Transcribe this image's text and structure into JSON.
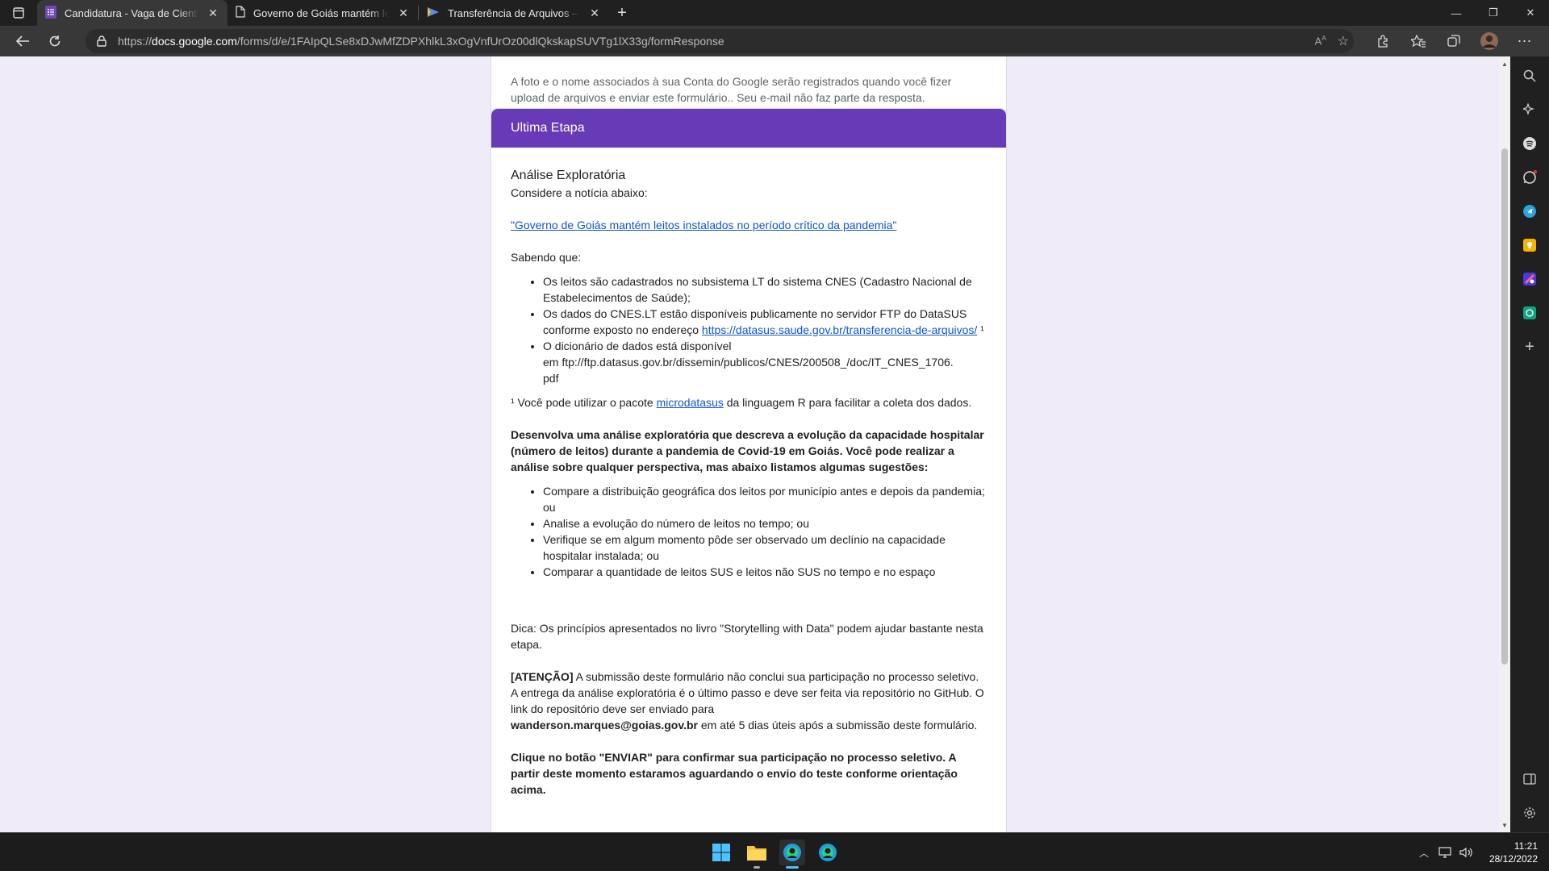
{
  "browser": {
    "tabs": [
      {
        "title": "Candidatura - Vaga de Cientista",
        "active": true,
        "icon": "google-forms-icon"
      },
      {
        "title": "Governo de Goiás mantém leitos",
        "active": false,
        "icon": "document-icon"
      },
      {
        "title": "Transferência de Arquivos – DATA",
        "active": false,
        "icon": "datasus-icon"
      }
    ],
    "url_prefix": "https://",
    "url_host": "docs.google.com",
    "url_path": "/forms/d/e/1FAIpQLSe8xDJwMfZDPXhlkL3xOgVnfUrOz00dlQkskapSUVTg1lX33g/formResponse"
  },
  "form": {
    "prev_card_text": "A foto e o nome associados à sua Conta do Google serão registrados quando você fizer upload de arquivos e enviar este formulário.. Seu e-mail não faz parte da resposta.",
    "section_header": "Ultima Etapa",
    "section_title": "Análise Exploratória",
    "intro": "Considere a notícia abaixo:",
    "news_link": "\"Governo de Goiás mantém leitos instalados no período crítico da pandemia\"",
    "knowing": "Sabendo que:",
    "facts": {
      "f1": "Os leitos são cadastrados no subsistema LT do sistema CNES (Cadastro Nacional de Estabelecimentos de Saúde);",
      "f2_text": "Os dados do CNES.LT estão disponíveis publicamente no servidor FTP do DataSUS conforme exposto no endereço ",
      "f2_link": "https://datasus.saude.gov.br/transferencia-de-arquivos/",
      "f2_sup": " ¹",
      "f3_a": "O dicionário de dados está disponível",
      "f3_b": "em ftp://ftp.datasus.gov.br/dissemin/publicos/CNES/200508_/doc/IT_CNES_1706.",
      "f3_c": "pdf"
    },
    "footnote_pre": "¹ Você pode utilizar o pacote ",
    "footnote_link": "microdatasus",
    "footnote_post": " da linguagem R para facilitar a coleta dos dados.",
    "task": "Desenvolva uma análise exploratória que descreva a evolução da capacidade hospitalar (número de leitos) durante a pandemia de Covid-19 em Goiás. Você pode realizar a análise sobre qualquer perspectiva, mas abaixo listamos algumas sugestões:",
    "suggestions": {
      "s1": "Compare a distribuição geográfica dos leitos por município antes e depois da pandemia; ou",
      "s2": "Analise a evolução do número de leitos no tempo; ou",
      "s3": "Verifique se em algum momento pôde ser observado um declínio na capacidade hospitalar instalada; ou",
      "s4": "Comparar a quantidade de leitos SUS e leitos não SUS no tempo e no espaço"
    },
    "tip": "Dica: Os princípios apresentados no livro \"Storytelling with Data\" podem ajudar bastante nesta etapa.",
    "attention_label": "[ATENÇÃO]",
    "attention_text": " A submissão deste formulário não conclui sua participação no processo seletivo. A entrega da análise exploratória é o último passo e deve ser feita via repositório no GitHub. O link do repositório deve ser enviado para ",
    "email": "wanderson.marques@goias.gov.br",
    "attention_tail": "  em até 5 dias úteis após a submissão deste formulário.",
    "final": "Clique no botão \"ENVIAR\" para confirmar sua participação no processo seletivo. A partir deste momento estaramos aguardando o envio do teste conforme orientação acima."
  },
  "taskbar": {
    "time": "11:21",
    "date": "28/12/2022"
  },
  "colors": {
    "form_accent": "#673ab7",
    "form_bg": "#f0ebf8",
    "link": "#1155cc"
  }
}
